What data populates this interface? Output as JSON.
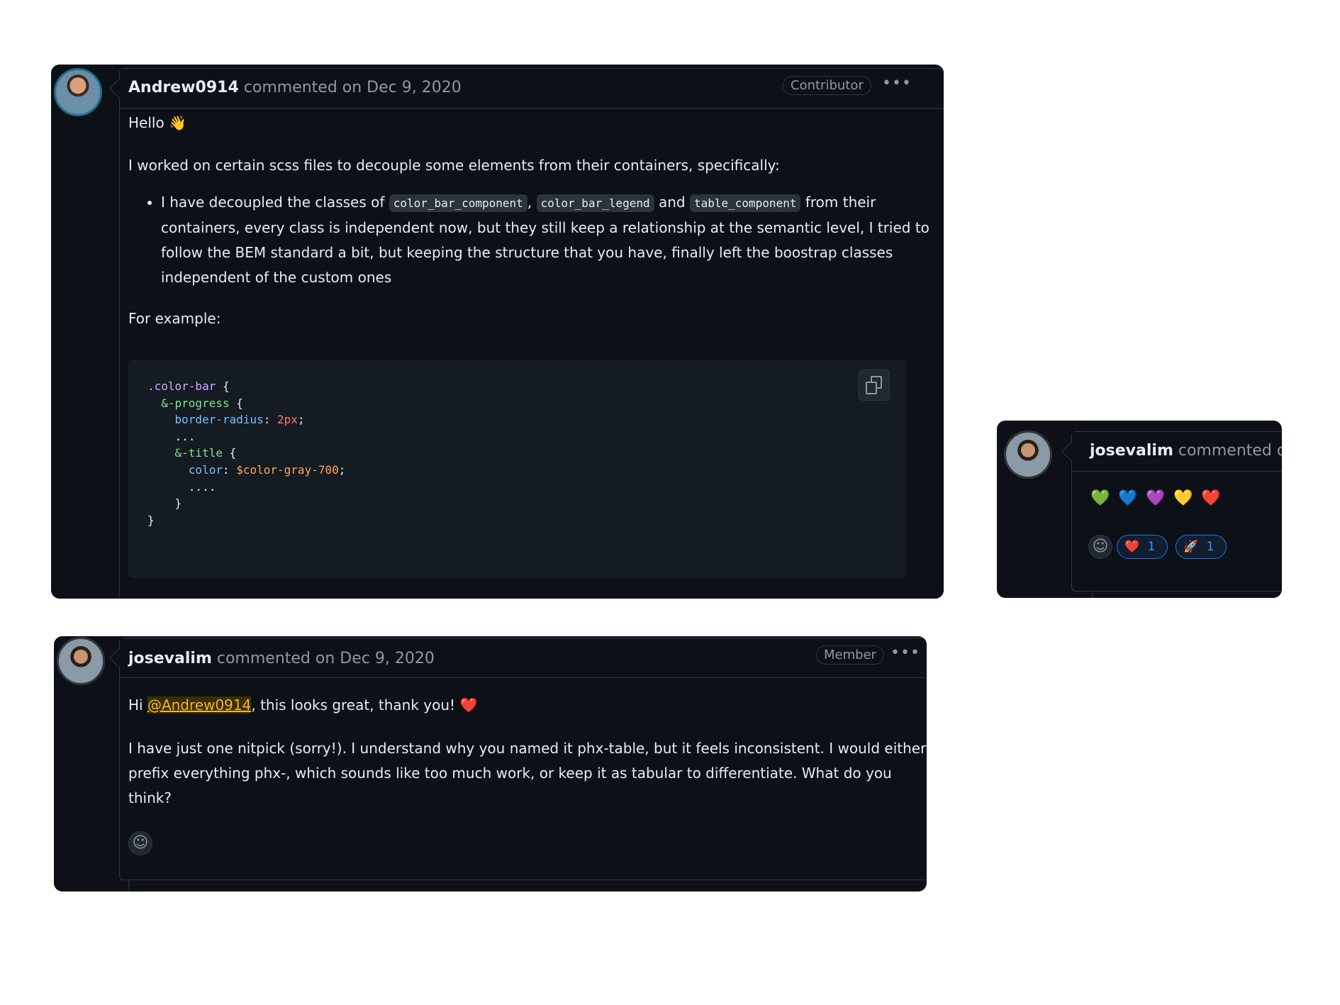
{
  "comment1": {
    "author": "Andrew0914",
    "meta": "commented on Dec 9, 2020",
    "badge": "Contributor",
    "more": "•••",
    "greeting": "Hello",
    "greeting_emoji": "👋",
    "intro": "I worked on certain scss files to decouple some elements from their containers, specifically:",
    "bullet": {
      "t1": "I have decoupled the classes of ",
      "c1": "color_bar_component",
      "t2": ", ",
      "c2": "color_bar_legend",
      "t3": " and ",
      "c3": "table_component",
      "t4": " from their containers, every class is independent now, but they still keep a relationship at the semantic level, I tried to follow the BEM standard a bit, but keeping the structure that you have, finally left the boostrap classes independent of the custom ones"
    },
    "example_label": "For example:",
    "code": {
      "l1_sel": ".color-bar",
      "l1_b": " {",
      "l2_amp": "&-progress",
      "l2_b": " {",
      "l3_prop": "border-radius",
      "l3_colon": ": ",
      "l3_val": "2px",
      "l3_end": ";",
      "l4": "...",
      "l5_amp": "&-title",
      "l5_b": " {",
      "l6_prop": "color",
      "l6_colon": ": ",
      "l6_val": "$color-gray-700",
      "l6_end": ";",
      "l7": "....",
      "l8": "}",
      "l9": "}"
    }
  },
  "comment2": {
    "author": "josevalim",
    "meta": "commented on",
    "hearts": [
      "💚",
      "💙",
      "💜",
      "💛",
      "❤️"
    ],
    "reactions": [
      {
        "emoji": "❤️",
        "count": "1"
      },
      {
        "emoji": "🚀",
        "count": "1"
      }
    ]
  },
  "comment3": {
    "author": "josevalim",
    "meta": "commented on Dec 9, 2020",
    "badge": "Member",
    "more": "•••",
    "line1_pre": "Hi ",
    "mention": "@Andrew0914",
    "line1_post": ", this looks great, thank you!",
    "line1_emoji": "❤️",
    "para": "I have just one nitpick (sorry!). I understand why you named it phx-table, but it feels inconsistent. I would either prefix everything phx-, which sounds like too much work, or keep it as tabular to differentiate. What do you think?"
  },
  "icons": {
    "add_reaction": "☺"
  }
}
